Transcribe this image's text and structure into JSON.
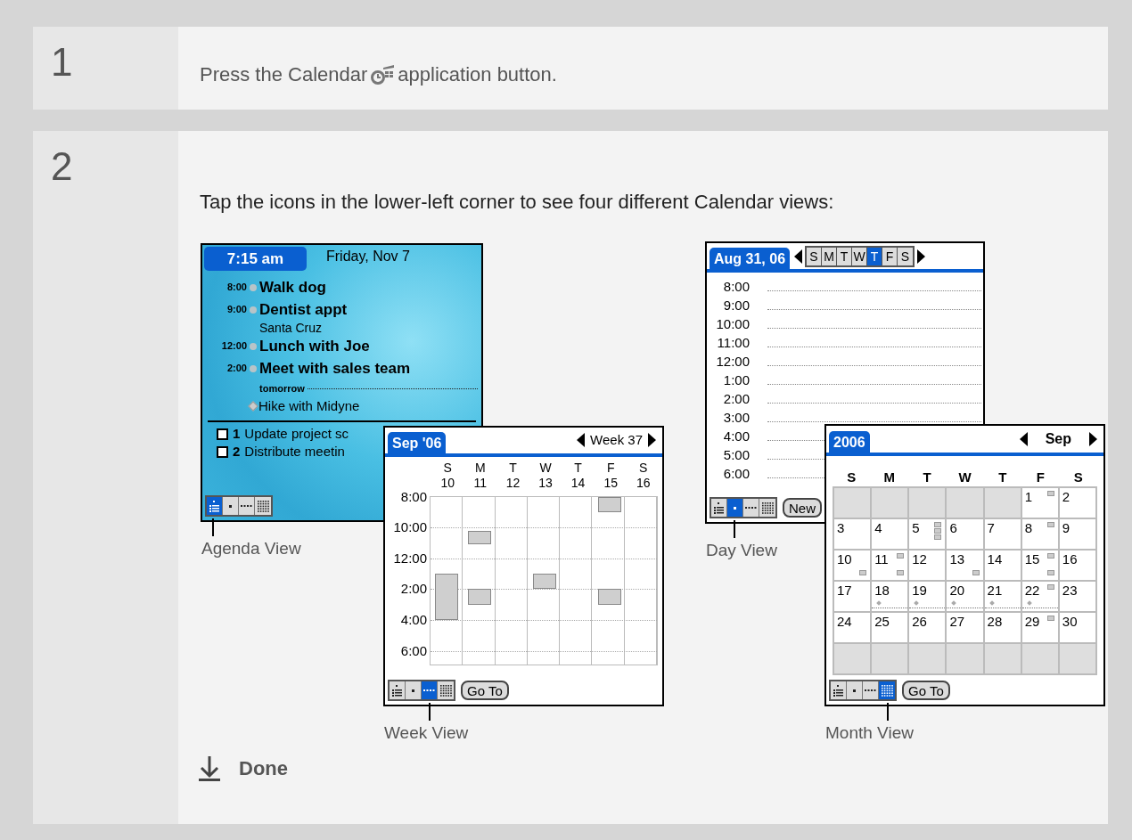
{
  "steps": [
    {
      "kind": "single",
      "number": "1",
      "text_before": "Press the Calendar",
      "text_after": "application button."
    },
    {
      "kind": "views",
      "number": "2",
      "text": "Tap the icons in the lower-left corner to see four different Calendar views:",
      "views": [
        {
          "kind": "agenda",
          "caption": "Agenda View",
          "clock": "7:15 am",
          "date": "Friday, Nov 7",
          "events": [
            {
              "time": "8:00",
              "title": "Walk dog"
            },
            {
              "time": "9:00",
              "title": "Dentist appt",
              "location": "Santa Cruz"
            },
            {
              "time": "12:00",
              "title": "Lunch with Joe"
            },
            {
              "time": "2:00",
              "title": "Meet with sales team"
            }
          ],
          "tomorrow_label": "tomorrow",
          "tomorrow_events": [
            {
              "title": "Hike with Midyne"
            }
          ],
          "tasks": [
            {
              "priority": "1",
              "title": "Update project sc",
              "checked": false
            },
            {
              "priority": "2",
              "title": "Distribute meetin",
              "checked": false
            }
          ],
          "view_buttons": [
            {
              "kind": "agenda",
              "selected": true
            },
            {
              "kind": "day",
              "selected": false
            },
            {
              "kind": "week",
              "selected": false
            },
            {
              "kind": "month",
              "selected": false
            }
          ]
        },
        {
          "kind": "day",
          "caption": "Day View",
          "title": "Aug 31, 06",
          "weekdays": [
            {
              "label": "S",
              "selected": false
            },
            {
              "label": "M",
              "selected": false
            },
            {
              "label": "T",
              "selected": false
            },
            {
              "label": "W",
              "selected": false
            },
            {
              "label": "T",
              "selected": true
            },
            {
              "label": "F",
              "selected": false
            },
            {
              "label": "S",
              "selected": false
            }
          ],
          "times": [
            "8:00",
            "9:00",
            "10:00",
            "11:00",
            "12:00",
            "1:00",
            "2:00",
            "3:00",
            "4:00",
            "5:00",
            "6:00"
          ],
          "button": "New",
          "view_buttons": [
            {
              "kind": "agenda",
              "selected": false
            },
            {
              "kind": "day",
              "selected": true
            },
            {
              "kind": "week",
              "selected": false
            },
            {
              "kind": "month",
              "selected": false
            }
          ]
        },
        {
          "kind": "week",
          "caption": "Week View",
          "title": "Sep '06",
          "period": "Week 37",
          "days": [
            {
              "letter": "S",
              "date": "10"
            },
            {
              "letter": "M",
              "date": "11"
            },
            {
              "letter": "T",
              "date": "12"
            },
            {
              "letter": "W",
              "date": "13"
            },
            {
              "letter": "T",
              "date": "14"
            },
            {
              "letter": "F",
              "date": "15"
            },
            {
              "letter": "S",
              "date": "16"
            }
          ],
          "times": [
            "8:00",
            "10:00",
            "12:00",
            "2:00",
            "4:00",
            "6:00"
          ],
          "button": "Go To",
          "view_buttons": [
            {
              "kind": "agenda",
              "selected": false
            },
            {
              "kind": "day",
              "selected": false
            },
            {
              "kind": "week",
              "selected": true
            },
            {
              "kind": "month",
              "selected": false
            }
          ]
        },
        {
          "kind": "month",
          "caption": "Month View",
          "title": "2006",
          "period": "Sep",
          "weekdays": [
            "S",
            "M",
            "T",
            "W",
            "T",
            "F",
            "S"
          ],
          "weeks": [
            [
              {
                "kind": "blank"
              },
              {
                "kind": "blank"
              },
              {
                "kind": "blank"
              },
              {
                "kind": "blank"
              },
              {
                "kind": "blank"
              },
              {
                "kind": "date",
                "date": "1",
                "top": true,
                "bottom": false,
                "stack": false,
                "repeat": false
              },
              {
                "kind": "date",
                "date": "2",
                "top": false,
                "bottom": false,
                "stack": false,
                "repeat": false
              }
            ],
            [
              {
                "kind": "date",
                "date": "3",
                "top": false,
                "bottom": false,
                "stack": false,
                "repeat": false
              },
              {
                "kind": "date",
                "date": "4",
                "top": false,
                "bottom": false,
                "stack": false,
                "repeat": false
              },
              {
                "kind": "date",
                "date": "5",
                "top": false,
                "bottom": false,
                "stack": true,
                "repeat": false
              },
              {
                "kind": "date",
                "date": "6",
                "top": false,
                "bottom": false,
                "stack": false,
                "repeat": false
              },
              {
                "kind": "date",
                "date": "7",
                "top": false,
                "bottom": false,
                "stack": false,
                "repeat": false
              },
              {
                "kind": "date",
                "date": "8",
                "top": true,
                "bottom": false,
                "stack": false,
                "repeat": false
              },
              {
                "kind": "date",
                "date": "9",
                "top": false,
                "bottom": false,
                "stack": false,
                "repeat": false
              }
            ],
            [
              {
                "kind": "date",
                "date": "10",
                "top": false,
                "bottom": true,
                "stack": false,
                "repeat": false
              },
              {
                "kind": "date",
                "date": "11",
                "top": true,
                "bottom": true,
                "stack": false,
                "repeat": false
              },
              {
                "kind": "date",
                "date": "12",
                "top": false,
                "bottom": false,
                "stack": false,
                "repeat": false
              },
              {
                "kind": "date",
                "date": "13",
                "top": false,
                "bottom": true,
                "stack": false,
                "repeat": false
              },
              {
                "kind": "date",
                "date": "14",
                "top": false,
                "bottom": false,
                "stack": false,
                "repeat": false
              },
              {
                "kind": "date",
                "date": "15",
                "top": true,
                "bottom": true,
                "stack": false,
                "repeat": false
              },
              {
                "kind": "date",
                "date": "16",
                "top": false,
                "bottom": false,
                "stack": false,
                "repeat": false
              }
            ],
            [
              {
                "kind": "date",
                "date": "17",
                "top": false,
                "bottom": false,
                "stack": false,
                "repeat": false
              },
              {
                "kind": "date",
                "date": "18",
                "top": false,
                "bottom": false,
                "stack": false,
                "repeat": true
              },
              {
                "kind": "date",
                "date": "19",
                "top": false,
                "bottom": false,
                "stack": false,
                "repeat": true
              },
              {
                "kind": "date",
                "date": "20",
                "top": false,
                "bottom": false,
                "stack": false,
                "repeat": true
              },
              {
                "kind": "date",
                "date": "21",
                "top": false,
                "bottom": false,
                "stack": false,
                "repeat": true
              },
              {
                "kind": "date",
                "date": "22",
                "top": true,
                "bottom": false,
                "stack": false,
                "repeat": true
              },
              {
                "kind": "date",
                "date": "23",
                "top": false,
                "bottom": false,
                "stack": false,
                "repeat": false
              }
            ],
            [
              {
                "kind": "date",
                "date": "24",
                "top": false,
                "bottom": false,
                "stack": false,
                "repeat": false
              },
              {
                "kind": "date",
                "date": "25",
                "top": false,
                "bottom": false,
                "stack": false,
                "repeat": false
              },
              {
                "kind": "date",
                "date": "26",
                "top": false,
                "bottom": false,
                "stack": false,
                "repeat": false
              },
              {
                "kind": "date",
                "date": "27",
                "top": false,
                "bottom": false,
                "stack": false,
                "repeat": false
              },
              {
                "kind": "date",
                "date": "28",
                "top": false,
                "bottom": false,
                "stack": false,
                "repeat": false
              },
              {
                "kind": "date",
                "date": "29",
                "top": true,
                "bottom": false,
                "stack": false,
                "repeat": false
              },
              {
                "kind": "date",
                "date": "30",
                "top": false,
                "bottom": false,
                "stack": false,
                "repeat": false
              }
            ],
            [
              {
                "kind": "blank"
              },
              {
                "kind": "blank"
              },
              {
                "kind": "blank"
              },
              {
                "kind": "blank"
              },
              {
                "kind": "blank"
              },
              {
                "kind": "blank"
              },
              {
                "kind": "blank"
              }
            ]
          ],
          "button": "Go To",
          "view_buttons": [
            {
              "kind": "agenda",
              "selected": false
            },
            {
              "kind": "day",
              "selected": false
            },
            {
              "kind": "week",
              "selected": false
            },
            {
              "kind": "month",
              "selected": true
            }
          ]
        }
      ],
      "done": "Done"
    }
  ]
}
